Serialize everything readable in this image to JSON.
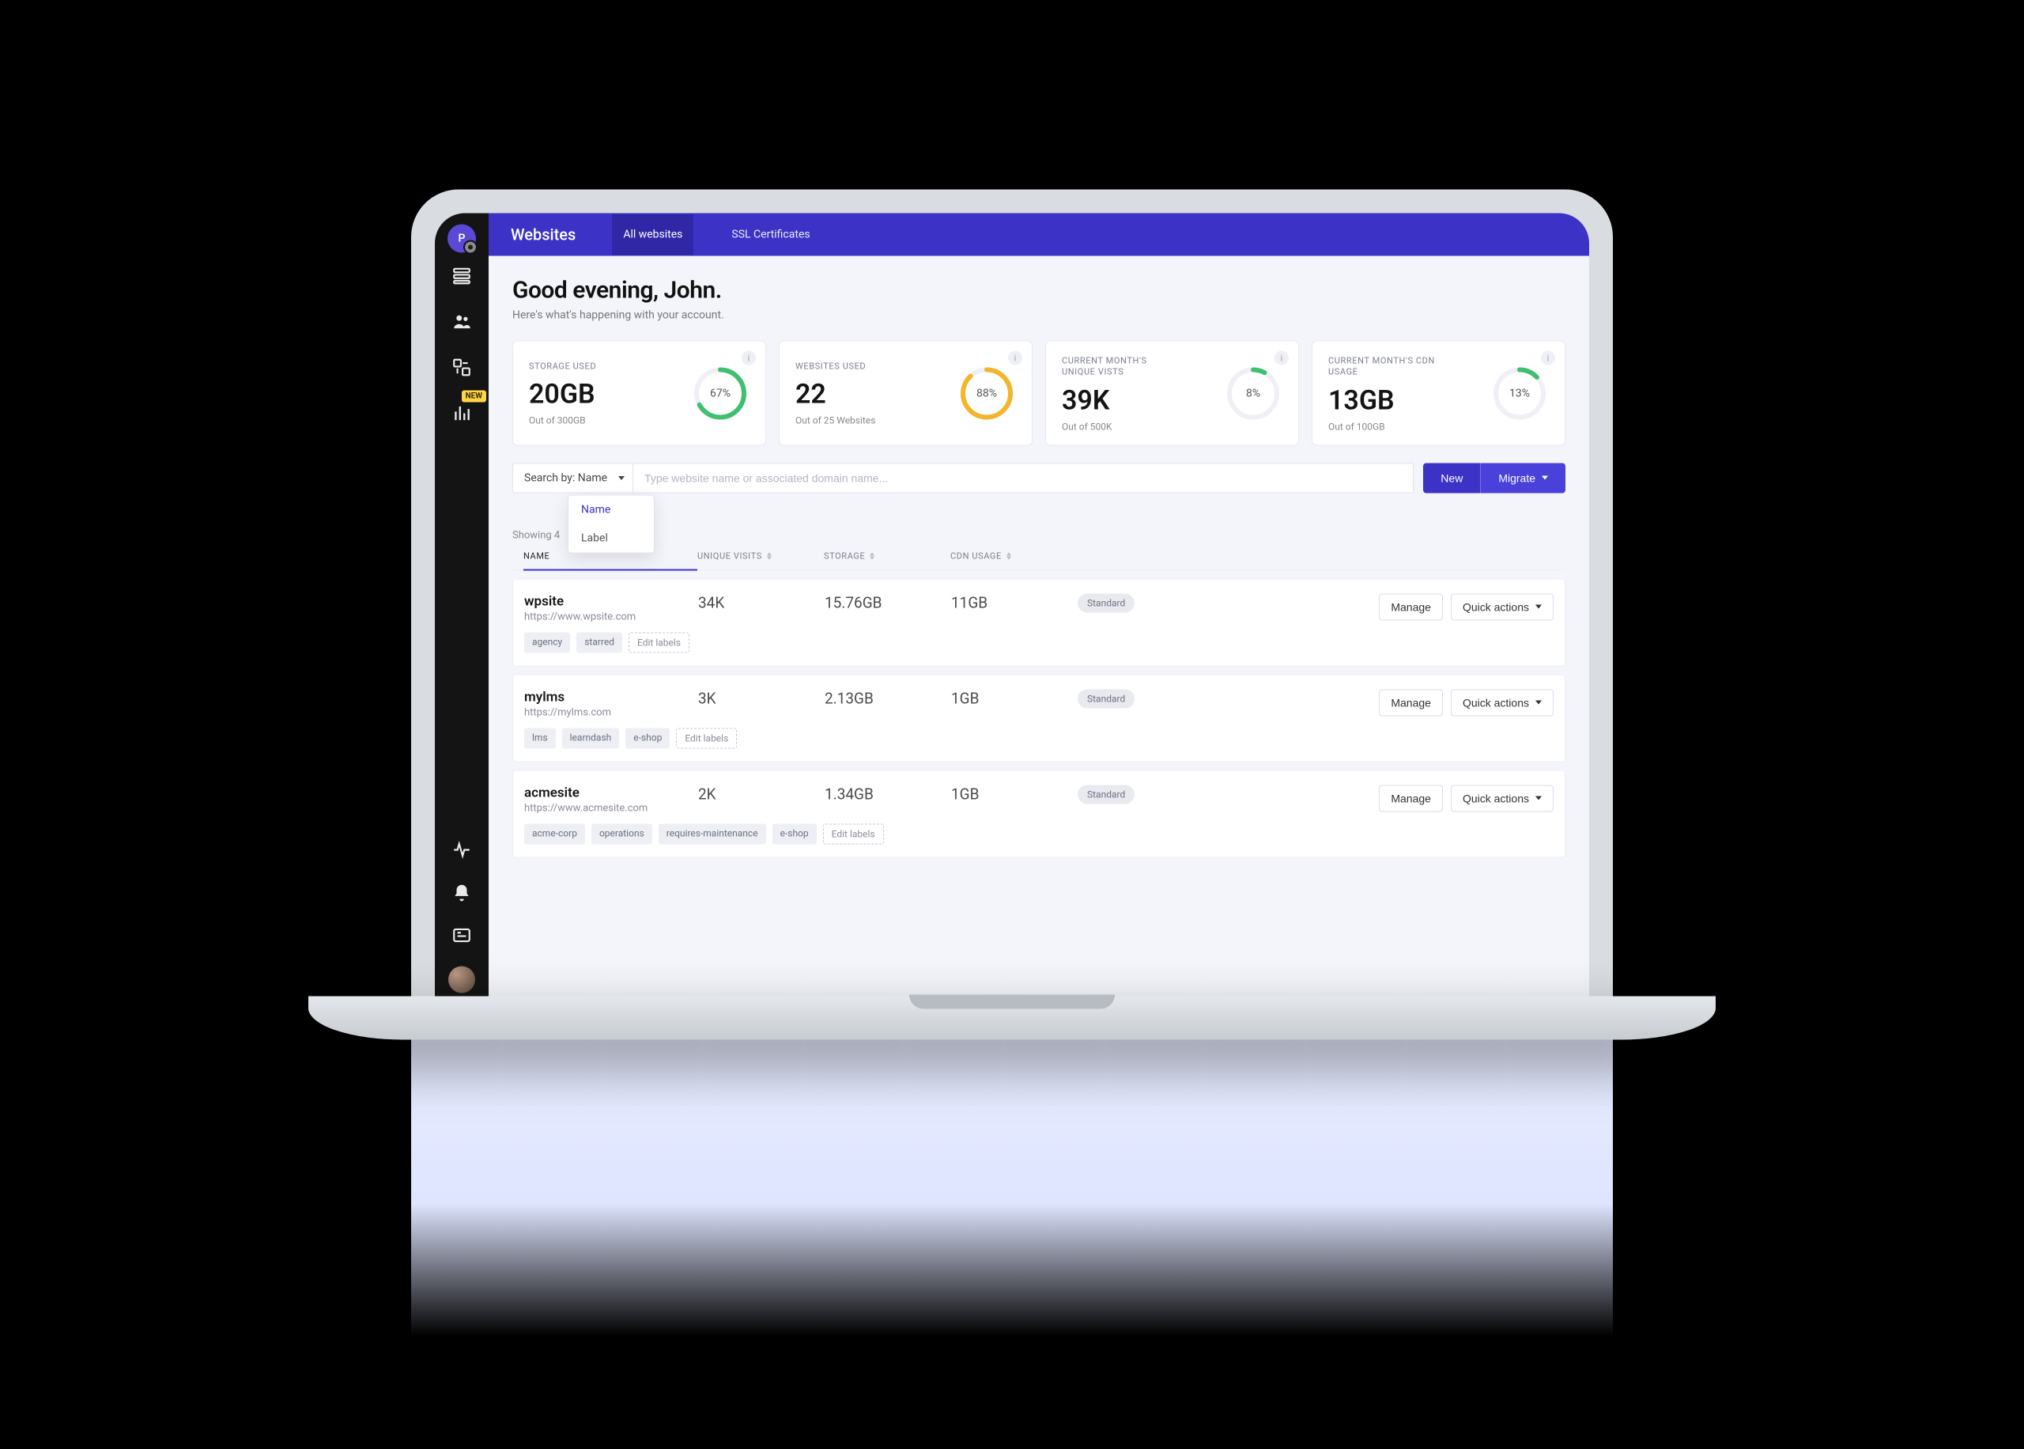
{
  "colors": {
    "primary": "#3c33c6",
    "primaryLight": "#4a40da",
    "statGreen": "#3fbf6f",
    "statAmber": "#f3b52a"
  },
  "sidebar": {
    "brand_letter": "P",
    "badge_new": "NEW"
  },
  "topbar": {
    "title": "Websites",
    "tabs": [
      {
        "label": "All websites",
        "active": true
      },
      {
        "label": "SSL Certificates",
        "active": false
      }
    ]
  },
  "greeting": {
    "headline": "Good evening, John.",
    "sub": "Here's what's happening with your account."
  },
  "stats": [
    {
      "label": "STORAGE USED",
      "value": "20GB",
      "sub": "Out of 300GB",
      "pct": 67,
      "ring": "#3fbf6f"
    },
    {
      "label": "WEBSITES USED",
      "value": "22",
      "sub": "Out of 25 Websites",
      "pct": 88,
      "ring": "#f3b52a"
    },
    {
      "label": "CURRENT MONTH'S UNIQUE VISTS",
      "value": "39K",
      "sub": "Out of 500K",
      "pct": 8,
      "ring": "#3fbf6f"
    },
    {
      "label": "CURRENT MONTH'S CDN USAGE",
      "value": "13GB",
      "sub": "Out of 100GB",
      "pct": 13,
      "ring": "#3fbf6f"
    }
  ],
  "search": {
    "by_label": "Search by: Name",
    "placeholder": "Type website name or associated domain name...",
    "dropdown": [
      "Name",
      "Label"
    ],
    "selected": "Name"
  },
  "buttons": {
    "new": "New",
    "migrate": "Migrate",
    "manage": "Manage",
    "quick": "Quick actions",
    "edit_labels": "Edit labels"
  },
  "table": {
    "showing": "Showing 4",
    "columns": [
      "NAME",
      "UNIQUE VISITS",
      "STORAGE",
      "CDN USAGE"
    ],
    "rows": [
      {
        "name": "wpsite",
        "url": "https://www.wpsite.com",
        "visits": "34K",
        "storage": "15.76GB",
        "cdn": "11GB",
        "plan": "Standard",
        "labels": [
          "agency",
          "starred"
        ]
      },
      {
        "name": "mylms",
        "url": "https://mylms.com",
        "visits": "3K",
        "storage": "2.13GB",
        "cdn": "1GB",
        "plan": "Standard",
        "labels": [
          "lms",
          "learndash",
          "e-shop"
        ]
      },
      {
        "name": "acmesite",
        "url": "https://www.acmesite.com",
        "visits": "2K",
        "storage": "1.34GB",
        "cdn": "1GB",
        "plan": "Standard",
        "labels": [
          "acme-corp",
          "operations",
          "requires-maintenance",
          "e-shop"
        ]
      }
    ]
  }
}
